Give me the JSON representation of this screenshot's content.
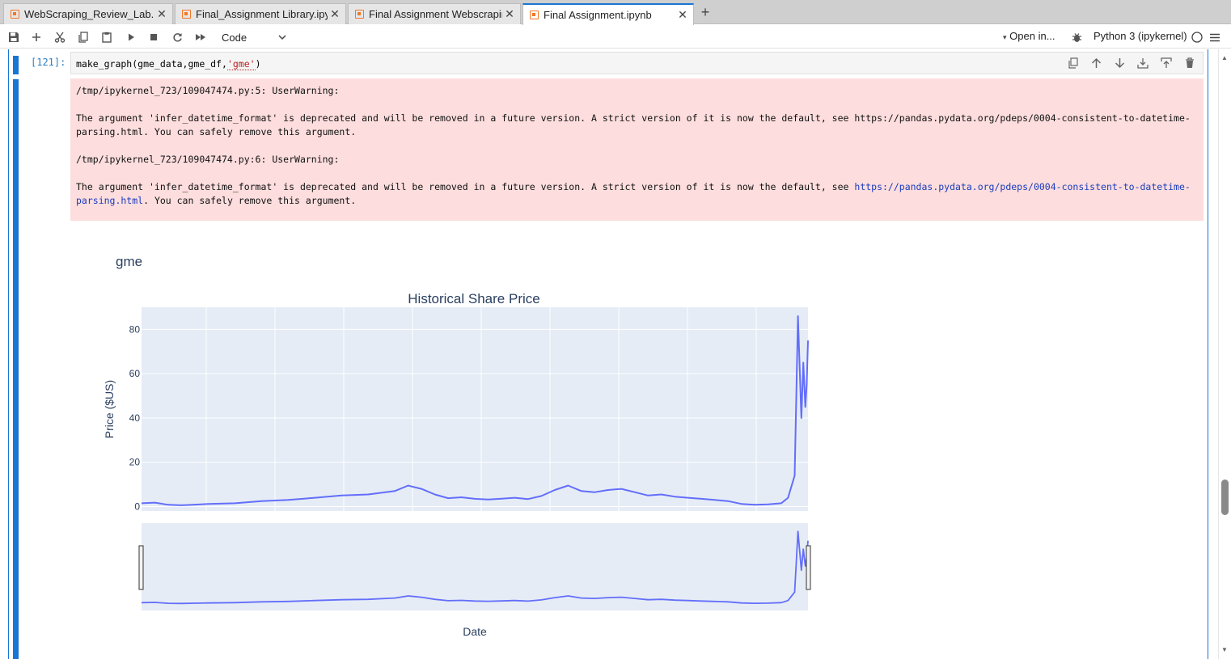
{
  "tabs": [
    {
      "label": "WebScraping_Review_Lab.ipynb",
      "active": false
    },
    {
      "label": "Final_Assignment Library.ipynb",
      "active": false
    },
    {
      "label": "Final Assignment Webscraping.ipynb",
      "active": false
    },
    {
      "label": "Final Assignment.ipynb",
      "active": true
    }
  ],
  "toolbar": {
    "cell_type": "Code",
    "open_in": "Open in...",
    "kernel": "Python 3 (ipykernel)"
  },
  "cell": {
    "prompt": "[121]:",
    "code_plain": "make_graph(gme_data,gme_df,",
    "code_string": "'gme'",
    "code_end": ")"
  },
  "stderr": {
    "warn1_head": "/tmp/ipykernel_723/109047474.py:5: UserWarning:",
    "warn1_body": "The argument 'infer_datetime_format' is deprecated and will be removed in a future version. A strict version of it is now the default, see https://pandas.pydata.org/pdeps/0004-consistent-to-datetime-parsing.html. You can safely remove this argument.",
    "warn2_head": "/tmp/ipykernel_723/109047474.py:6: UserWarning:",
    "warn2_pre": "The argument 'infer_datetime_format' is deprecated and will be removed in a future version. A strict version of it is now the default, see ",
    "warn2_link": "https://pandas.pydata.org/pdeps/0004-consistent-to-datetime-parsing.html",
    "warn2_post": ". You can safely remove this argument."
  },
  "chart_data": {
    "type": "line",
    "figure_title": "gme",
    "title": "Historical Share Price",
    "xlabel": "Date",
    "ylabel": "Price ($US)",
    "ylim": [
      -2,
      90
    ],
    "yticks": [
      0,
      20,
      40,
      60,
      80
    ],
    "x_index_range": [
      0,
      100
    ],
    "x": [
      0,
      2,
      4,
      6,
      8,
      10,
      14,
      18,
      22,
      26,
      30,
      34,
      38,
      40,
      42,
      44,
      46,
      48,
      50,
      52,
      54,
      56,
      58,
      60,
      62,
      64,
      66,
      68,
      70,
      72,
      74,
      76,
      78,
      80,
      82,
      84,
      86,
      88,
      90,
      92,
      94,
      96,
      97,
      98,
      98.5,
      99,
      99.3,
      99.6,
      99.8,
      100
    ],
    "values": [
      1.5,
      1.8,
      0.8,
      0.6,
      0.9,
      1.2,
      1.5,
      2.5,
      3.0,
      4.0,
      5.0,
      5.5,
      7.0,
      9.5,
      8.0,
      5.5,
      3.8,
      4.2,
      3.5,
      3.2,
      3.6,
      4.0,
      3.4,
      4.8,
      7.5,
      9.5,
      7.0,
      6.5,
      7.5,
      8.0,
      6.5,
      5.0,
      5.5,
      4.5,
      4.0,
      3.5,
      3.0,
      2.5,
      1.2,
      0.8,
      1.0,
      1.5,
      4.0,
      14.0,
      86.0,
      40.0,
      65.0,
      45.0,
      55.0,
      75.0
    ],
    "series": [
      {
        "color": "#636efa"
      }
    ],
    "rangeslider": true
  }
}
